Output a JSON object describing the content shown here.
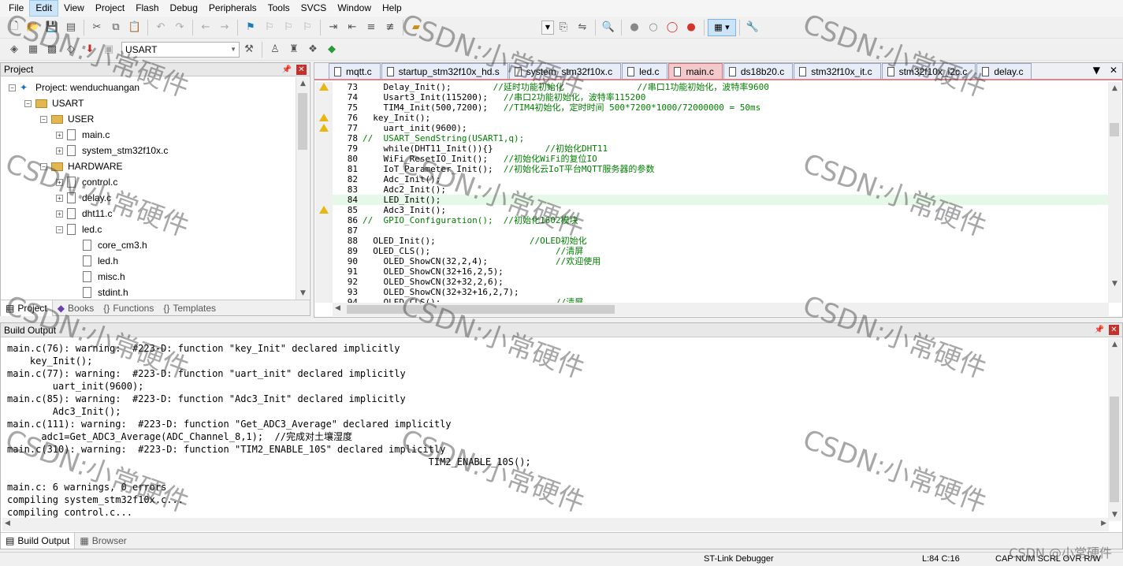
{
  "menu": [
    "File",
    "Edit",
    "View",
    "Project",
    "Flash",
    "Debug",
    "Peripherals",
    "Tools",
    "SVCS",
    "Window",
    "Help"
  ],
  "toolbar": {
    "target": "USART"
  },
  "project_panel": {
    "title": "Project",
    "tree": [
      {
        "label": "Project: wenduchuangan",
        "level": 0,
        "kind": "project",
        "exp": "-"
      },
      {
        "label": "USART",
        "level": 1,
        "kind": "target",
        "exp": "-"
      },
      {
        "label": "USER",
        "level": 2,
        "kind": "folder",
        "exp": "-"
      },
      {
        "label": "main.c",
        "level": 3,
        "kind": "file",
        "exp": "+"
      },
      {
        "label": "system_stm32f10x.c",
        "level": 3,
        "kind": "file",
        "exp": "+"
      },
      {
        "label": "HARDWARE",
        "level": 2,
        "kind": "folder",
        "exp": "-"
      },
      {
        "label": "control.c",
        "level": 3,
        "kind": "file",
        "exp": "+"
      },
      {
        "label": "delay.c",
        "level": 3,
        "kind": "file",
        "exp": "+"
      },
      {
        "label": "dht11.c",
        "level": 3,
        "kind": "file",
        "exp": "+"
      },
      {
        "label": "led.c",
        "level": 3,
        "kind": "file",
        "exp": "-"
      },
      {
        "label": "core_cm3.h",
        "level": 4,
        "kind": "file",
        "exp": ""
      },
      {
        "label": "led.h",
        "level": 4,
        "kind": "file",
        "exp": ""
      },
      {
        "label": "misc.h",
        "level": 4,
        "kind": "file",
        "exp": ""
      },
      {
        "label": "stdint.h",
        "level": 4,
        "kind": "file",
        "exp": ""
      }
    ],
    "tabs": [
      "Project",
      "Books",
      "Functions",
      "Templates"
    ]
  },
  "editor": {
    "tabs": [
      "mqtt.c",
      "startup_stm32f10x_hd.s",
      "system_stm32f10x.c",
      "led.c",
      "main.c",
      "ds18b20.c",
      "stm32f10x_it.c",
      "stm32f10x_i2c.c",
      "delay.c"
    ],
    "active_tab": "main.c",
    "lines": [
      {
        "n": "73",
        "code": "    Delay_Init();",
        "comment": "        //延时功能初始化              //串口1功能初始化，波特率9600",
        "warn": true
      },
      {
        "n": "74",
        "code": "    Usart3_Init(115200);",
        "comment": "   //串口2功能初始化，波特率115200",
        "warn": false
      },
      {
        "n": "75",
        "code": "    TIM4_Init(500,7200);",
        "comment": "   //TIM4初始化，定时时间 500*7200*1000/72000000 = 50ms",
        "warn": false
      },
      {
        "n": "76",
        "code": "  key_Init();",
        "comment": "",
        "warn": true
      },
      {
        "n": "77",
        "code": "    uart_init(9600);",
        "comment": "",
        "warn": true
      },
      {
        "n": "78",
        "code": "",
        "comment": "//  USART_SendString(USART1,q);",
        "warn": false
      },
      {
        "n": "79",
        "code": "    while(DHT11_Init()){}",
        "comment": "          //初始化DHT11",
        "warn": false
      },
      {
        "n": "80",
        "code": "    WiFi_ResetIO_Init();",
        "comment": "   //初始化WiFi的复位IO",
        "warn": false
      },
      {
        "n": "81",
        "code": "    IoT_Parameter_Init();",
        "comment": "  //初始化云IoT平台MQTT服务器的参数",
        "warn": false
      },
      {
        "n": "82",
        "code": "    Adc_Init();",
        "comment": "",
        "warn": false
      },
      {
        "n": "83",
        "code": "    Adc2_Init();",
        "comment": "",
        "warn": false
      },
      {
        "n": "84",
        "code": "    LED_Init();",
        "comment": "",
        "warn": false
      },
      {
        "n": "85",
        "code": "    Adc3_Init();",
        "comment": "",
        "warn": true
      },
      {
        "n": "86",
        "code": "",
        "comment": "//  GPIO_Configuration();  //初始化1602模块",
        "warn": false
      },
      {
        "n": "87",
        "code": "",
        "comment": "",
        "warn": false
      },
      {
        "n": "88",
        "code": "  OLED_Init();",
        "comment": "                  //OLED初始化",
        "warn": false
      },
      {
        "n": "89",
        "code": "  OLED_CLS();",
        "comment": "                        //清屏",
        "warn": false
      },
      {
        "n": "90",
        "code": "    OLED_ShowCN(32,2,4);",
        "comment": "             //欢迎使用",
        "warn": false
      },
      {
        "n": "91",
        "code": "    OLED_ShowCN(32+16,2,5);",
        "comment": "",
        "warn": false
      },
      {
        "n": "92",
        "code": "    OLED_ShowCN(32+32,2,6);",
        "comment": "",
        "warn": false
      },
      {
        "n": "93",
        "code": "    OLED_ShowCN(32+32+16,2,7);",
        "comment": "",
        "warn": false
      },
      {
        "n": "94",
        "code": "    OLED_CLS();",
        "comment": "                      //清屏",
        "warn": false
      }
    ],
    "current_line": "84"
  },
  "build": {
    "title": "Build Output",
    "lines": [
      "main.c(76): warning:  #223-D: function \"key_Init\" declared implicitly",
      "    key_Init();",
      "main.c(77): warning:  #223-D: function \"uart_init\" declared implicitly",
      "        uart_init(9600);",
      "main.c(85): warning:  #223-D: function \"Adc3_Init\" declared implicitly",
      "        Adc3_Init();",
      "main.c(111): warning:  #223-D: function \"Get_ADC3_Average\" declared implicitly",
      "      adc1=Get_ADC3_Average(ADC_Channel_8,1);  //完成对土壤湿度",
      "main.c(310): warning:  #223-D: function \"TIM2_ENABLE_10S\" declared implicitly",
      "                                                                          TIM2_ENABLE_10S();",
      "main.c: 6 warnings, 0 errors",
      "compiling system_stm32f10x.c...",
      "compiling control.c..."
    ],
    "tabs": [
      "Build Output",
      "Browser"
    ]
  },
  "status": {
    "debugger": "ST-Link Debugger",
    "position": "L:84 C:16",
    "indicators": "CAP NUM SCRL OVR R/W"
  },
  "watermark": {
    "text": "CSDN:小常硬件",
    "corner": "CSDN @小常硬件"
  }
}
